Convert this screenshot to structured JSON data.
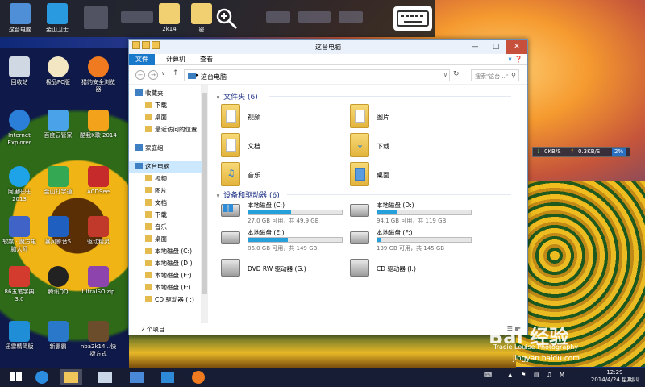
{
  "topbar": {
    "items": [
      {
        "label": "这台电脑"
      },
      {
        "label": "金山卫士"
      },
      {
        "label": "2k14"
      },
      {
        "label": "密"
      }
    ],
    "zoom_icon": "zoom-in-icon",
    "keyboard_icon": "keyboard-icon"
  },
  "desktop_icons": [
    {
      "label": "回收站"
    },
    {
      "label": "极品PC版"
    },
    {
      "label": "猎豹安全浏览器"
    },
    {
      "label": "Internet Explorer"
    },
    {
      "label": "百度云管家"
    },
    {
      "label": "酷我K歌 2014"
    },
    {
      "label": "阿里旺旺 2013"
    },
    {
      "label": "金山打字通"
    },
    {
      "label": "ACDSee"
    },
    {
      "label": "软媒 · 魔方电脑大师"
    },
    {
      "label": "暴风影音5"
    },
    {
      "label": "驱动精灵"
    },
    {
      "label": "86五笔字典 3.0"
    },
    {
      "label": "腾讯QQ"
    },
    {
      "label": "UltraISO.zip"
    },
    {
      "label": "迅雷精简版"
    },
    {
      "label": "新霸霸"
    },
    {
      "label": "nba2k14...快捷方式"
    }
  ],
  "explorer": {
    "title": "这台电脑",
    "ribbon_tabs": [
      {
        "label": "文件",
        "active": true
      },
      {
        "label": "计算机",
        "active": false
      },
      {
        "label": "查看",
        "active": false
      }
    ],
    "address": "这台电脑",
    "search_placeholder": "搜索\"这台...\"",
    "nav": [
      {
        "label": "收藏夹",
        "level": 0
      },
      {
        "label": "下载",
        "level": 1
      },
      {
        "label": "桌面",
        "level": 1
      },
      {
        "label": "最近访问的位置",
        "level": 1
      },
      {
        "label": "家庭组",
        "level": 0
      },
      {
        "label": "这台电脑",
        "level": 0,
        "selected": true
      },
      {
        "label": "视频",
        "level": 1
      },
      {
        "label": "图片",
        "level": 1
      },
      {
        "label": "文档",
        "level": 1
      },
      {
        "label": "下载",
        "level": 1
      },
      {
        "label": "音乐",
        "level": 1
      },
      {
        "label": "桌面",
        "level": 1
      },
      {
        "label": "本地磁盘 (C:)",
        "level": 1
      },
      {
        "label": "本地磁盘 (D:)",
        "level": 1
      },
      {
        "label": "本地磁盘 (E:)",
        "level": 1
      },
      {
        "label": "本地磁盘 (F:)",
        "level": 1
      },
      {
        "label": "CD 驱动器 (I:)",
        "level": 1
      }
    ],
    "folders_header": "文件夹 (6)",
    "folders": [
      {
        "label": "视频"
      },
      {
        "label": "图片"
      },
      {
        "label": "文档"
      },
      {
        "label": "下载"
      },
      {
        "label": "音乐"
      },
      {
        "label": "桌面"
      }
    ],
    "drives_header": "设备和驱动器 (6)",
    "drives": [
      {
        "label": "本地磁盘 (C:)",
        "size": "27.0 GB 可用，共 49.9 GB",
        "used": 0.46
      },
      {
        "label": "本地磁盘 (D:)",
        "size": "94.1 GB 可用，共 119 GB",
        "used": 0.21
      },
      {
        "label": "本地磁盘 (E:)",
        "size": "86.0 GB 可用，共 149 GB",
        "used": 0.42
      },
      {
        "label": "本地磁盘 (F:)",
        "size": "139 GB 可用，共 145 GB",
        "used": 0.04
      },
      {
        "label": "DVD RW 驱动器 (G:)"
      },
      {
        "label": "CD 驱动器 (I:)"
      }
    ],
    "status": "12 个项目"
  },
  "netmeter": {
    "down": "0KB/S",
    "up": "0.3KB/S",
    "pct": "2%"
  },
  "watermark": {
    "brand": "Bai 经验",
    "caption": "Tracie Louise Photography",
    "site": "jingyan.baidu.com"
  },
  "taskbar": {
    "time": "12:29",
    "date": "2014/4/24 星期四",
    "ime": "M"
  }
}
